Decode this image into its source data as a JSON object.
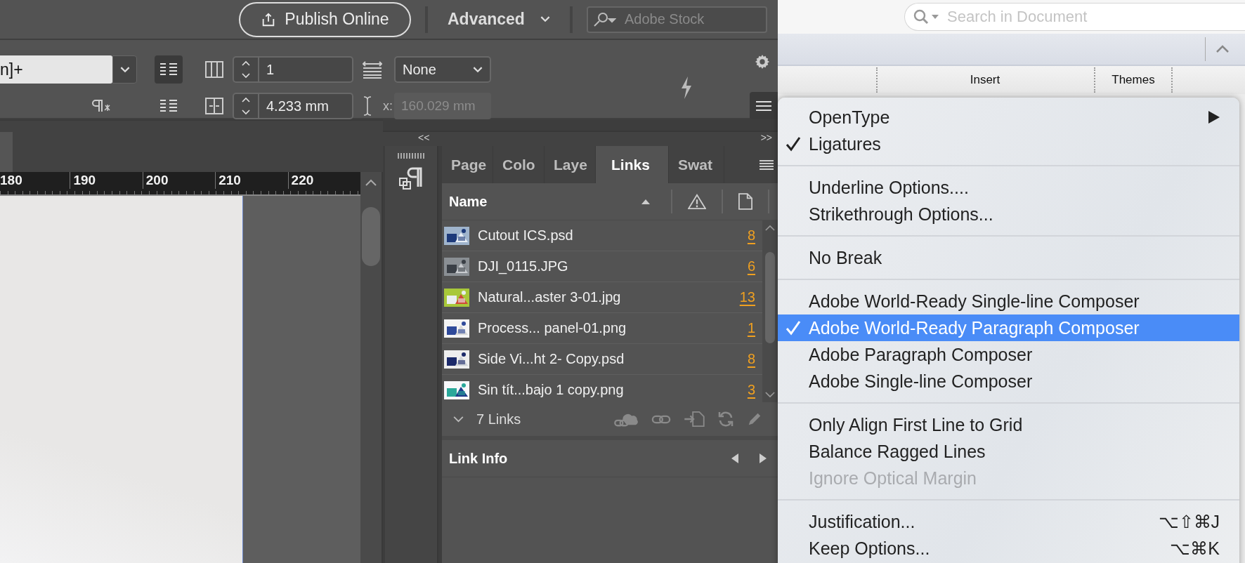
{
  "top_bar": {
    "publish_button": "Publish Online",
    "workspace": "Advanced",
    "stock_search": {
      "placeholder": "Adobe Stock"
    }
  },
  "control_bar": {
    "style_field": "n]+",
    "paragraph_buttons": [
      {
        "selected": true
      },
      {
        "selected": false
      }
    ],
    "columns": "1",
    "gutter": "4.233 mm",
    "span": "None",
    "width_label": "x:",
    "width_field": {
      "value": "160.029 mm",
      "disabled": true
    }
  },
  "ruler": {
    "ticks": [
      "180",
      "190",
      "200",
      "210",
      "220"
    ]
  },
  "panel": {
    "collapse_left": "<<",
    "collapse_right": ">>",
    "tabs": [
      {
        "label": "Page",
        "selected": false
      },
      {
        "label": "Colo",
        "selected": false
      },
      {
        "label": "Laye",
        "selected": false
      },
      {
        "label": "Links",
        "selected": true
      },
      {
        "label": "Swat",
        "selected": false
      }
    ],
    "name_column": "Name",
    "links": [
      {
        "name": "Cutout ICS.psd",
        "count": "8"
      },
      {
        "name": "DJI_0115.JPG",
        "count": "6"
      },
      {
        "name": "Natural...aster 3-01.jpg",
        "count": "13"
      },
      {
        "name": "Process... panel-01.png",
        "count": "1"
      },
      {
        "name": "Side Vi...ht 2- Copy.psd",
        "count": "8"
      },
      {
        "name": "Sin tít...bajo 1 copy.png",
        "count": "3"
      }
    ],
    "footer": "7 Links",
    "link_info": "Link Info"
  },
  "word": {
    "search": {
      "placeholder": "Search in Document"
    },
    "ribbon_groups": [
      "Insert",
      "Themes"
    ]
  },
  "menu": {
    "sections": [
      [
        {
          "label": "OpenType",
          "checked": false,
          "selected": false,
          "disabled": false,
          "submenu": true
        },
        {
          "label": "Ligatures",
          "checked": true,
          "selected": false,
          "disabled": false,
          "submenu": false
        }
      ],
      [
        {
          "label": "Underline Options....",
          "checked": false,
          "selected": false,
          "disabled": false,
          "submenu": false
        },
        {
          "label": "Strikethrough Options...",
          "checked": false,
          "selected": false,
          "disabled": false,
          "submenu": false
        }
      ],
      [
        {
          "label": "No Break",
          "checked": false,
          "selected": false,
          "disabled": false,
          "submenu": false
        }
      ],
      [
        {
          "label": "Adobe World-Ready Single-line Composer",
          "checked": false,
          "selected": false,
          "disabled": false,
          "submenu": false
        },
        {
          "label": "Adobe World-Ready Paragraph Composer",
          "checked": true,
          "selected": true,
          "disabled": false,
          "submenu": false
        },
        {
          "label": "Adobe Paragraph Composer",
          "checked": false,
          "selected": false,
          "disabled": false,
          "submenu": false
        },
        {
          "label": "Adobe Single-line Composer",
          "checked": false,
          "selected": false,
          "disabled": false,
          "submenu": false
        }
      ],
      [
        {
          "label": "Only Align First Line to Grid",
          "checked": false,
          "selected": false,
          "disabled": false,
          "submenu": false
        },
        {
          "label": "Balance Ragged Lines",
          "checked": false,
          "selected": false,
          "disabled": false,
          "submenu": false
        },
        {
          "label": "Ignore Optical Margin",
          "checked": false,
          "selected": false,
          "disabled": true,
          "submenu": false
        }
      ],
      [
        {
          "label": "Justification...",
          "checked": false,
          "selected": false,
          "disabled": false,
          "submenu": false,
          "shortcut": "⌥⇧⌘J"
        },
        {
          "label": "Keep Options...",
          "checked": false,
          "selected": false,
          "disabled": false,
          "submenu": false,
          "shortcut": "⌥⌘K"
        }
      ]
    ]
  }
}
